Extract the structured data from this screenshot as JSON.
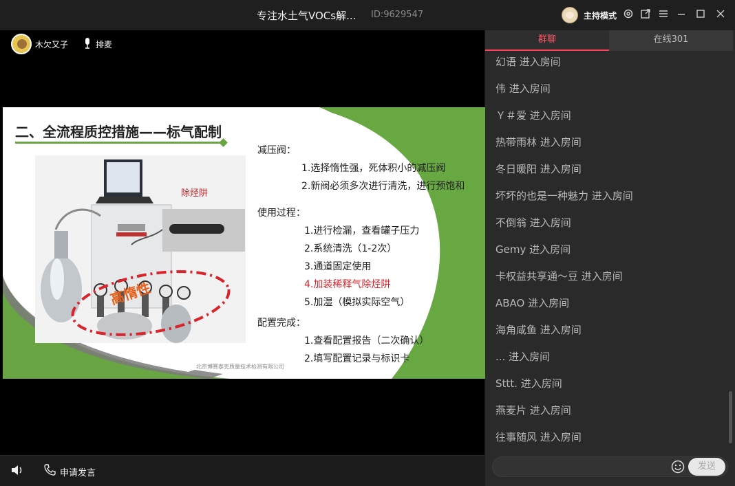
{
  "window": {
    "title": "专注水土气VOCs解...",
    "room_id": "ID:9629547",
    "host_mode": "主持模式"
  },
  "presenter": {
    "name": "木欠又子",
    "mic_queue_label": "排麦"
  },
  "slide": {
    "title": "二、全流程质控措施——标气配制",
    "photo_label": "除烃阱",
    "ellipse_label": "高惰性",
    "lines": [
      "减压阀：",
      "1.选择惰性强，死体积小的减压阀",
      "2.新阀必须多次进行清洗，进行预饱和",
      "使用过程：",
      "1.进行检漏，查看罐子压力",
      "2.系统清洗（1-2次）",
      "3.通道固定使用",
      "4.加装稀释气除烃阱",
      "5.加湿（模拟实际空气）",
      "配置完成：",
      "1.查看配置报告（二次确认）",
      "2.填写配置记录与标识卡"
    ],
    "footer": "北京博赛泰克质量技术检测有限公司",
    "colors": {
      "accent_green": "#6aa544",
      "highlight_red": "#d9242b"
    }
  },
  "bottombar": {
    "apply_speak": "申请发言"
  },
  "chat": {
    "tabs": {
      "group": "群聊",
      "online": "在线301"
    },
    "messages": [
      "幻语 进入房间",
      "伟 进入房间",
      "Ｙ＃爱 进入房间",
      "热带雨林 进入房间",
      "冬日暖阳 进入房间",
      "坏坏的也是一种魅力 进入房间",
      "不倒翁 进入房间",
      "Gemy 进入房间",
      "卡权益共享通～豆 进入房间",
      "ABAO 进入房间",
      "海角咸鱼 进入房间",
      "... 进入房间",
      "Sttt. 进入房间",
      "燕麦片 进入房间",
      "往事随风 进入房间"
    ],
    "input_value": "",
    "send_label": "发送"
  },
  "icons": {
    "settings": "gear-icon",
    "popout": "popout-icon",
    "menu": "menu-icon",
    "minimize": "minimize-icon",
    "maximize": "maximize-icon",
    "close": "close-icon",
    "mic": "microphone-icon",
    "volume": "volume-icon",
    "phone": "phone-icon",
    "emoji": "emoji-icon"
  }
}
